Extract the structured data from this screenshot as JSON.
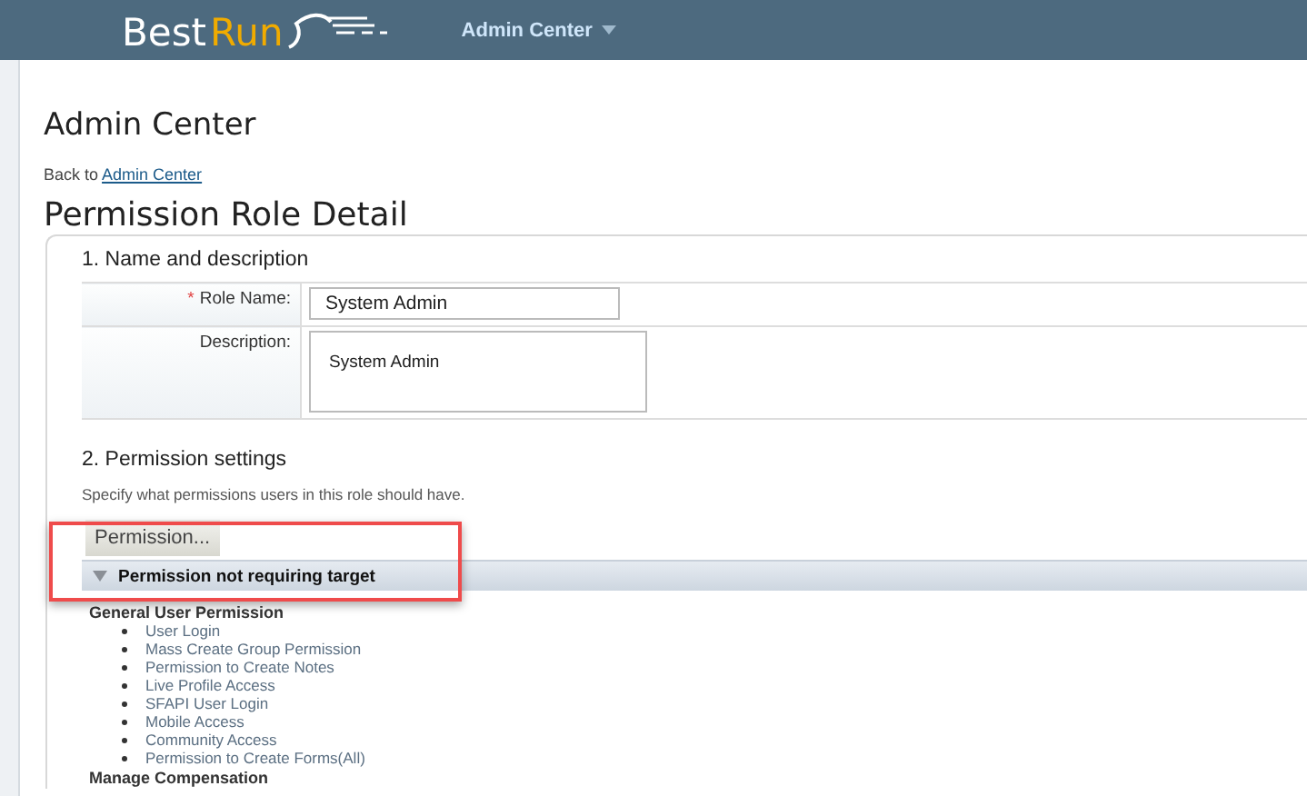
{
  "header": {
    "logo": {
      "part_1": "Best",
      "part_2": "Run"
    },
    "nav_menu": "Admin Center"
  },
  "page_title": "Admin Center",
  "breadcrumb": {
    "prefix": "Back to",
    "link": "Admin Center"
  },
  "section_title": "Permission Role Detail",
  "name_section": {
    "heading": "1. Name and description",
    "fields": [
      {
        "label": "Role Name:",
        "required_mark": "*",
        "value": "System Admin",
        "kind": "input"
      },
      {
        "label": "Description:",
        "value": "System Admin",
        "kind": "textarea"
      }
    ]
  },
  "permission_section": {
    "heading": "2. Permission settings",
    "hint": "Specify what permissions users in this role should have.",
    "button": "Permission...",
    "highlighted": true,
    "group": {
      "title": "Permission not requiring target",
      "expanded": true,
      "categories": [
        {
          "name": "General User Permission",
          "items": [
            "User Login",
            "Mass Create Group Permission",
            "Permission to Create Notes",
            "Live Profile Access",
            "SFAPI User Login",
            "Mobile Access",
            "Community Access",
            "Permission to Create Forms(All)"
          ]
        },
        {
          "name": "Manage Compensation"
        }
      ]
    }
  }
}
